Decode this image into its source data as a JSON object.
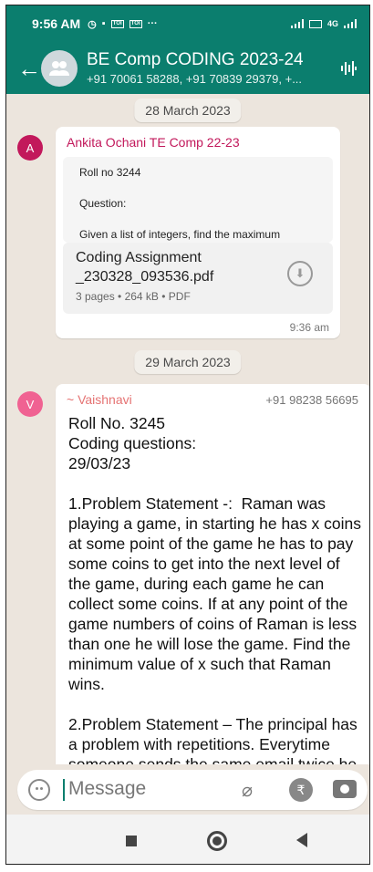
{
  "status_bar": {
    "time": "9:56 AM",
    "icons_left": [
      "alarm-icon",
      "media-icon",
      "app-icon-1",
      "app-icon-2",
      "more-dots-icon"
    ],
    "network_label": "4G"
  },
  "header": {
    "title": "BE Comp CODING 2023-24",
    "subtitle": "+91 70061 58288, +91 70839 29379, +...",
    "back_label": "←"
  },
  "chat": {
    "date1": "28 March 2023",
    "msg1": {
      "avatar_letter": "A",
      "avatar_color": "#C2185B",
      "sender": "Ankita Ochani TE Comp 22-23",
      "preview_lines": [
        "Roll no 3244",
        "Question:",
        "Given a list of integers, find the maximum"
      ],
      "file_name_line1": "Coding Assignment",
      "file_name_line2": "_230328_093536.pdf",
      "file_meta": "3 pages • 264 kB • PDF",
      "time": "9:36 am"
    },
    "date2": "29 March 2023",
    "msg2": {
      "avatar_letter": "V",
      "avatar_color": "#F06292",
      "sender": "~ Vaishnavi",
      "phone": "+91 98238 56695",
      "text": "Roll No. 3245\nCoding questions:\n29/03/23\n\n1.Problem Statement -:  Raman was playing a game, in starting he has x coins at some point of the game he has to pay some coins to get into the next level of the game, during each game he can collect some coins. If at any point of the  game numbers of coins of Raman is less than one he will lose the game. Find the minimum value of x such that Raman wins.\n\n2.Problem Statement – The principal has a problem with repetitions. Everytime someone sends the same email twice he becomes angry and"
    }
  },
  "input": {
    "placeholder": "Message",
    "rupee_symbol": "₹"
  }
}
